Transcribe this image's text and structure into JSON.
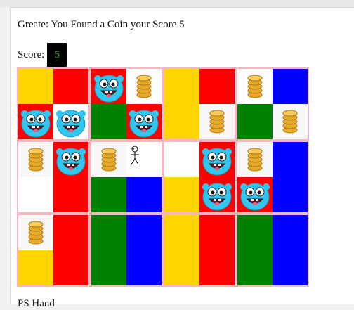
{
  "status": {
    "message": "Greate: You Found a Coin your Score 5",
    "score_label": "Score:",
    "score_value": "5"
  },
  "colors": {
    "yellow": "#ffd400",
    "red": "#ff0000",
    "green": "#008000",
    "blue": "#0000ff",
    "white": "#ffffff",
    "empty": "#f7f7f7",
    "border": "#f4b6c1"
  },
  "board": {
    "rows": [
      [
        [
          "yellow",
          "red",
          "red:monster",
          "white:monster"
        ],
        [
          "red:monster",
          "white:coin",
          "green",
          "red:monster"
        ],
        [
          "yellow",
          "red",
          "yellow",
          "empty:coin"
        ],
        [
          "white:coin",
          "blue",
          "green",
          "empty:coin"
        ]
      ],
      [
        [
          "empty:coin",
          "red:monster",
          "white",
          "red"
        ],
        [
          "empty:coin",
          "white:player",
          "green",
          "blue"
        ],
        [
          "white",
          "red:monster",
          "yellow",
          "red:monster"
        ],
        [
          "empty:coin",
          "blue",
          "red:monster",
          "blue"
        ]
      ],
      [
        [
          "empty:coin",
          "red",
          "yellow",
          "red"
        ],
        [
          "green",
          "blue",
          "green",
          "blue"
        ],
        [
          "yellow",
          "red",
          "yellow",
          "red"
        ],
        [
          "green",
          "blue",
          "green",
          "blue"
        ]
      ]
    ]
  },
  "footer": "PS Hand"
}
